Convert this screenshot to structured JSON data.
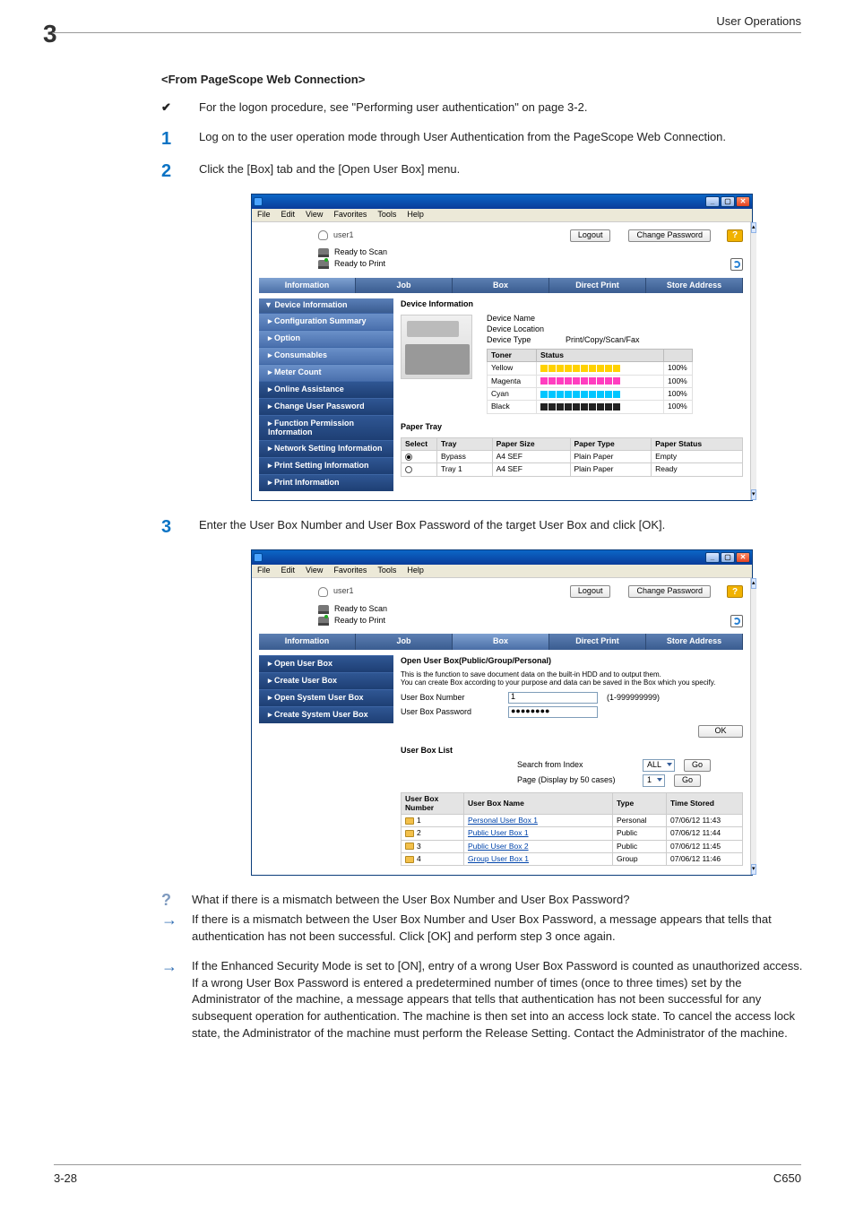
{
  "page": {
    "header": "User Operations",
    "chapter": "3",
    "footer_left": "3-28",
    "footer_right": "C650"
  },
  "section": {
    "title": "<From PageScope Web Connection>",
    "tick": "For the logon procedure, see \"Performing user authentication\" on page 3-2.",
    "step1": "Log on to the user operation mode through User Authentication from the PageScope Web Connection.",
    "step2": "Click the [Box] tab and the [Open User Box] menu.",
    "step3": "Enter the User Box Number and User Box Password of the target User Box and click [OK]."
  },
  "qa": {
    "question": "What if there is a mismatch between the User Box Number and User Box Password?",
    "answer1": "If there is a mismatch between the User Box Number and User Box Password, a message appears that tells that authentication has not been successful. Click [OK] and perform step 3 once again.",
    "answer2": "If the Enhanced Security Mode is set to [ON], entry of a wrong User Box Password is counted as unauthorized access. If a wrong User Box Password is entered a predetermined number of times (once to three times) set by the Administrator of the machine, a message appears that tells that authentication has not been successful for any subsequent operation for authentication. The machine is then set into an access lock state. To cancel the access lock state, the Administrator of the machine must perform the Release Setting. Contact the Administrator of the machine."
  },
  "win_menu": {
    "file": "File",
    "edit": "Edit",
    "view": "View",
    "fav": "Favorites",
    "tools": "Tools",
    "help": "Help"
  },
  "app_top": {
    "user": "user1",
    "logout": "Logout",
    "change_pw": "Change Password",
    "ready_scan": "Ready to Scan",
    "ready_print": "Ready to Print"
  },
  "tabs": {
    "info": "Information",
    "job": "Job",
    "box": "Box",
    "direct": "Direct Print",
    "store": "Store Address"
  },
  "sidebar1": {
    "head": "Device Information",
    "items": [
      "Configuration Summary",
      "Option",
      "Consumables",
      "Meter Count",
      "Online Assistance",
      "Change User Password",
      "Function Permission Information",
      "Network Setting Information",
      "Print Setting Information",
      "Print Information"
    ]
  },
  "panel1": {
    "title": "Device Information",
    "device_name_lbl": "Device Name",
    "device_loc_lbl": "Device Location",
    "device_type_lbl": "Device Type",
    "device_type_val": "Print/Copy/Scan/Fax",
    "th_toner": "Toner",
    "th_status": "Status",
    "toners": [
      {
        "name": "Yellow",
        "cls": "y",
        "pct": "100%"
      },
      {
        "name": "Magenta",
        "cls": "m",
        "pct": "100%"
      },
      {
        "name": "Cyan",
        "cls": "c",
        "pct": "100%"
      },
      {
        "name": "Black",
        "cls": "k",
        "pct": "100%"
      }
    ],
    "paper_title": "Paper Tray",
    "paper_headers": {
      "select": "Select",
      "tray": "Tray",
      "size": "Paper Size",
      "type": "Paper Type",
      "status": "Paper Status"
    },
    "paper_rows": [
      {
        "sel": "on",
        "tray": "Bypass",
        "size": "A4 SEF",
        "type": "Plain Paper",
        "status": "Empty"
      },
      {
        "sel": "off",
        "tray": "Tray 1",
        "size": "A4 SEF",
        "type": "Plain Paper",
        "status": "Ready"
      }
    ]
  },
  "sidebar2": {
    "items": [
      "Open User Box",
      "Create User Box",
      "Open System User Box",
      "Create System User Box"
    ]
  },
  "panel2": {
    "title": "Open User Box(Public/Group/Personal)",
    "desc1": "This is the function to save document data on the built-in HDD and to output them.",
    "desc2": "You can create Box according to your purpose and data can be saved in the Box which you specify.",
    "num_lbl": "User Box Number",
    "num_val": "1",
    "num_hint": "(1-999999999)",
    "pw_lbl": "User Box Password",
    "pw_val": "●●●●●●●●",
    "ok": "OK",
    "list_title": "User Box List",
    "search_lbl": "Search from Index",
    "search_sel": "ALL",
    "go": "Go",
    "page_lbl": "Page (Display by 50 cases)",
    "page_sel": "1",
    "th": {
      "num": "User Box Number",
      "name": "User Box Name",
      "type": "Type",
      "time": "Time Stored"
    },
    "rows": [
      {
        "num": "1",
        "name": "Personal User Box 1",
        "type": "Personal",
        "time": "07/06/12 11:43"
      },
      {
        "num": "2",
        "name": "Public User Box 1",
        "type": "Public",
        "time": "07/06/12 11:44"
      },
      {
        "num": "3",
        "name": "Public User Box 2",
        "type": "Public",
        "time": "07/06/12 11:45"
      },
      {
        "num": "4",
        "name": "Group User Box 1",
        "type": "Group",
        "time": "07/06/12 11:46"
      }
    ]
  }
}
